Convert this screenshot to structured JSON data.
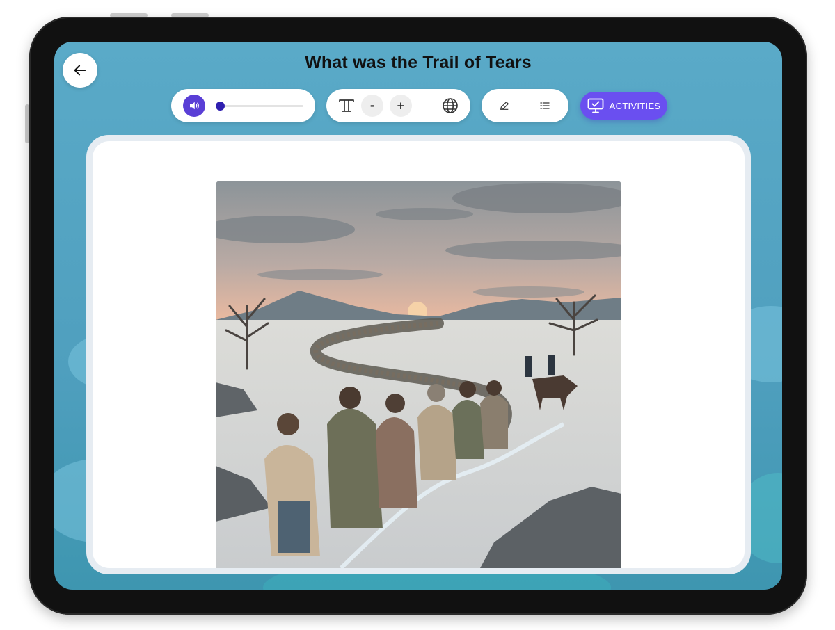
{
  "header": {
    "title": "What was the Trail of Tears"
  },
  "audio": {
    "progress": 0.0
  },
  "text_tools": {
    "decrease_label": "-",
    "increase_label": "+"
  },
  "activities": {
    "label": "ACTIVITIES"
  },
  "colors": {
    "accent": "#6a4ff0",
    "background": "#56a6c4",
    "speaker": "#5a3fd6",
    "progress": "#2f1fb0"
  },
  "icons": {
    "back": "arrow-left-icon",
    "speaker": "speaker-icon",
    "text_style": "text-style-icon",
    "translate": "globe-icon",
    "annotate": "pencil-icon",
    "outline": "list-icon",
    "activities": "monitor-check-icon"
  }
}
